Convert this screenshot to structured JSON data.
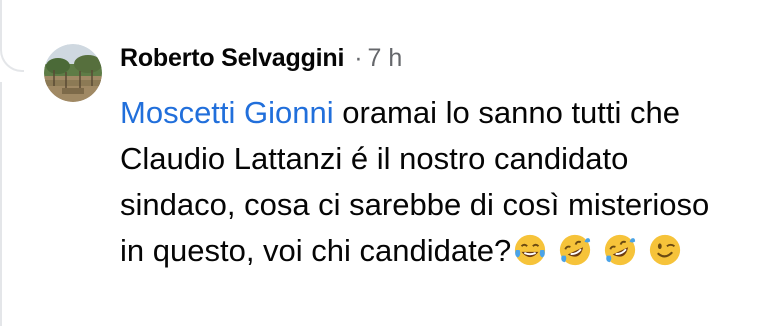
{
  "comment": {
    "author": "Roberto Selvaggini",
    "timestamp": "7 h",
    "mention": "Moscetti Gionni",
    "text_after_mention": " oramai lo sanno tutti che Claudio Lattanzi é il nostro candidato sindaco, cosa ci sarebbe di così misterioso in questo, voi chi candidate?",
    "emojis": [
      "tears-of-joy-emoji",
      "rolling-laughing-emoji",
      "rolling-laughing-emoji",
      "winking-face-emoji"
    ]
  }
}
